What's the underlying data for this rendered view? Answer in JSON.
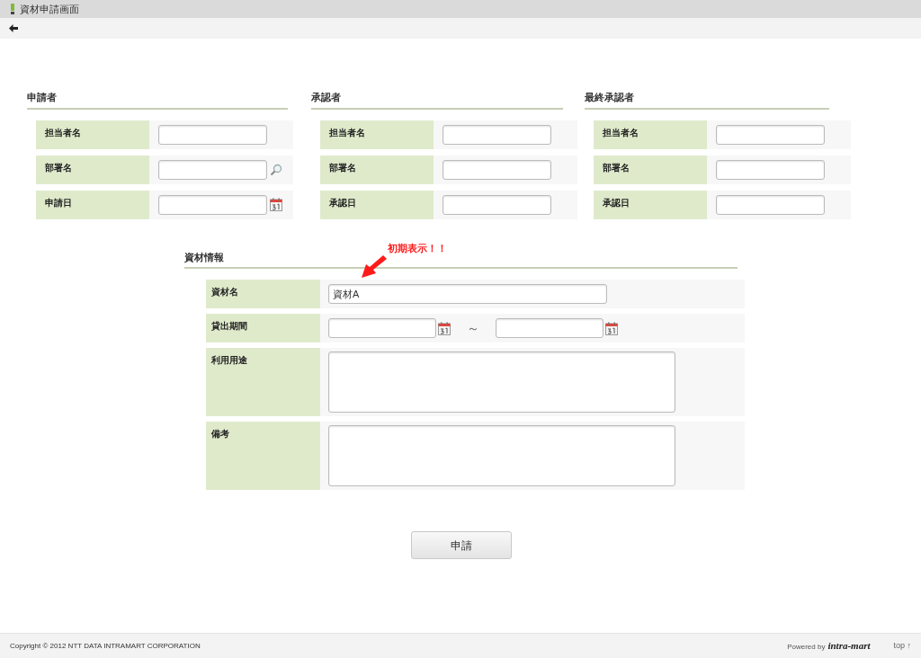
{
  "title_bar": {
    "title": "資材申請画面"
  },
  "top_sections": [
    {
      "title": "申請者",
      "fields": [
        {
          "label": "担当者名",
          "kind": "text"
        },
        {
          "label": "部署名",
          "kind": "search"
        },
        {
          "label": "申請日",
          "kind": "date"
        }
      ]
    },
    {
      "title": "承認者",
      "fields": [
        {
          "label": "担当者名",
          "kind": "text"
        },
        {
          "label": "部署名",
          "kind": "text"
        },
        {
          "label": "承認日",
          "kind": "text"
        }
      ]
    },
    {
      "title": "最終承認者",
      "fields": [
        {
          "label": "担当者名",
          "kind": "text"
        },
        {
          "label": "部署名",
          "kind": "text"
        },
        {
          "label": "承認日",
          "kind": "text"
        }
      ]
    }
  ],
  "material": {
    "title": "資材情報",
    "annotation": "初期表示！！",
    "fields": [
      {
        "label": "資材名",
        "kind": "text",
        "value": "資材A"
      },
      {
        "label": "貸出期間",
        "kind": "date_range",
        "separator": "～"
      },
      {
        "label": "利用用途",
        "kind": "textarea"
      },
      {
        "label": "備考",
        "kind": "textarea"
      }
    ]
  },
  "submit_button": "申請",
  "footer": {
    "copyright": "Copyright © 2012 NTT DATA INTRAMART CORPORATION",
    "powered_by": "Powered by",
    "logo": "intra-mart",
    "top_link": "top ↑"
  }
}
